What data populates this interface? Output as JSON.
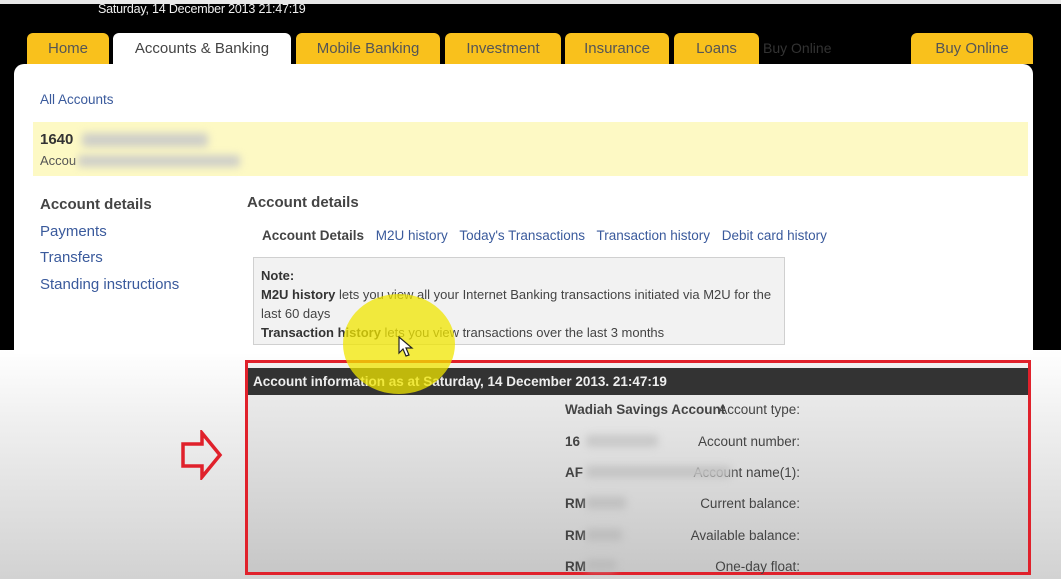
{
  "header": {
    "datetime": "Saturday, 14 December 2013 21:47:19",
    "tabs": [
      {
        "label": "Home",
        "active": false
      },
      {
        "label": "Accounts & Banking",
        "active": true
      },
      {
        "label": "Mobile Banking",
        "active": false
      },
      {
        "label": "Investment",
        "active": false
      },
      {
        "label": "Insurance",
        "active": false
      },
      {
        "label": "Loans",
        "active": false
      },
      {
        "label": "Buy Online",
        "active": false
      }
    ],
    "ghost_label": "Buy Online"
  },
  "breadcrumb": {
    "all_accounts": "All Accounts"
  },
  "account_banner": {
    "number_prefix": "1640",
    "subtitle_prefix": "Accou"
  },
  "sidebar": {
    "items": [
      {
        "label": "Account details",
        "current": true
      },
      {
        "label": "Payments",
        "current": false
      },
      {
        "label": "Transfers",
        "current": false
      },
      {
        "label": "Standing instructions",
        "current": false
      }
    ]
  },
  "main": {
    "title": "Account details",
    "subtabs": [
      {
        "label": "Account Details",
        "current": true
      },
      {
        "label": "M2U history",
        "current": false
      },
      {
        "label": "Today's Transactions",
        "current": false
      },
      {
        "label": "Transaction history",
        "current": false
      },
      {
        "label": "Debit card history",
        "current": false
      }
    ],
    "note": {
      "heading": "Note:",
      "line1_bold": "M2U history",
      "line1_rest": " lets you view all your Internet Banking transactions initiated via M2U for the last 60 days",
      "line2_bold": "Transaction history",
      "line2_rest": " lets you view transactions over the last 3 months"
    },
    "info": {
      "header": "Account information as at Saturday, 14 December 2013. 21:47:19",
      "rows": [
        {
          "label": "Account type:",
          "value": "Wadiah Savings Account"
        },
        {
          "label": "Account number:",
          "value": "16"
        },
        {
          "label": "Account name(1):",
          "value": "AF"
        },
        {
          "label": "Current balance:",
          "value": "RM"
        },
        {
          "label": "Available balance:",
          "value": "RM"
        },
        {
          "label": "One-day float:",
          "value": "RM"
        }
      ]
    }
  },
  "colors": {
    "tab_yellow": "#f9c11c",
    "annotation_red": "#e0212b",
    "link_blue": "#3a5a9c",
    "banner_yellow": "#fdf9c4"
  }
}
